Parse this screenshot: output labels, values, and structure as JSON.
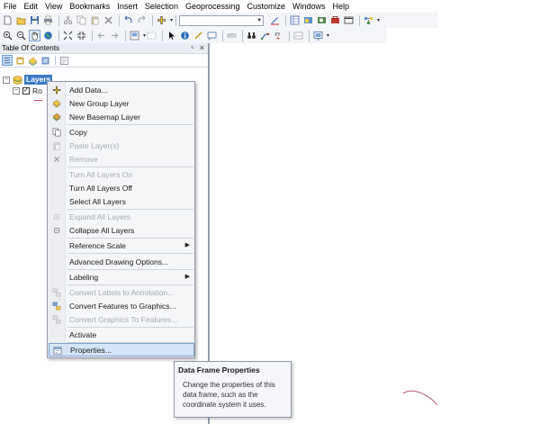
{
  "menubar": {
    "items": [
      "File",
      "Edit",
      "View",
      "Bookmarks",
      "Insert",
      "Selection",
      "Geoprocessing",
      "Customize",
      "Windows",
      "Help"
    ]
  },
  "toolbar1": {
    "buttons": [
      "new-document-icon",
      "open-icon",
      "save-icon",
      "print-icon",
      "cut-icon",
      "copy-icon",
      "paste-icon",
      "delete-icon",
      "undo-icon",
      "redo-icon",
      "add-data-icon"
    ],
    "scale_combo_value": "",
    "right_buttons": [
      "editor-icon",
      "table-icon",
      "catalog-icon",
      "search-window-icon",
      "arctoolbox-icon",
      "python-icon",
      "model-builder-icon"
    ]
  },
  "toolbar2": {
    "buttons": [
      "zoom-in-icon",
      "zoom-out-icon",
      "pan-icon",
      "full-extent-icon",
      "fixed-zoom-in-icon",
      "fixed-zoom-out-icon",
      "back-icon",
      "forward-icon",
      "layout-icon",
      "select-features-icon",
      "select-elements-icon",
      "identify-icon",
      "hyperlink-icon",
      "html-popup-icon",
      "measure-icon",
      "find-icon",
      "find-route-icon",
      "goto-xy-icon",
      "time-slider-icon",
      "viewer-icon"
    ]
  },
  "toc": {
    "title": "Table Of Contents",
    "pin_glyph": "ᛎ",
    "close_glyph": "×",
    "tree": {
      "root_label": "Layers",
      "child_label": "Ro"
    }
  },
  "context_menu": {
    "items": [
      {
        "label": "Add Data...",
        "icon": "add-data-icon",
        "enabled": true
      },
      {
        "label": "New Group Layer",
        "icon": "group-layer-icon",
        "enabled": true
      },
      {
        "label": "New Basemap Layer",
        "icon": "basemap-layer-icon",
        "enabled": true
      },
      {
        "label": "Copy",
        "icon": "copy-icon",
        "enabled": true
      },
      {
        "label": "Paste Layer(s)",
        "icon": "paste-icon",
        "enabled": false
      },
      {
        "label": "Remove",
        "icon": "remove-icon",
        "enabled": false
      },
      {
        "label": "Turn All Layers On",
        "icon": "",
        "enabled": false
      },
      {
        "label": "Turn All Layers Off",
        "icon": "",
        "enabled": true
      },
      {
        "label": "Select All Layers",
        "icon": "",
        "enabled": true
      },
      {
        "label": "Expand All Layers",
        "icon": "expand-icon",
        "enabled": false
      },
      {
        "label": "Collapse All Layers",
        "icon": "collapse-icon",
        "enabled": true
      },
      {
        "label": "Reference Scale",
        "icon": "",
        "enabled": true,
        "submenu": true
      },
      {
        "label": "Advanced Drawing Options...",
        "icon": "",
        "enabled": true
      },
      {
        "label": "Labeling",
        "icon": "",
        "enabled": true,
        "submenu": true
      },
      {
        "label": "Convert Labels to Annotation...",
        "icon": "convert-labels-icon",
        "enabled": false
      },
      {
        "label": "Convert Features to Graphics...",
        "icon": "convert-features-icon",
        "enabled": true
      },
      {
        "label": "Convert Graphics To Features...",
        "icon": "convert-graphics-icon",
        "enabled": false
      },
      {
        "label": "Activate",
        "icon": "",
        "enabled": true
      },
      {
        "label": "Properties...",
        "icon": "properties-icon",
        "enabled": true,
        "hover": true
      }
    ]
  },
  "tooltip": {
    "title": "Data Frame Properties",
    "body": "Change the properties of this data frame, such as the coordinate system it uses."
  },
  "colors": {
    "selection": "#3a79c7",
    "hover": "#d5e5f8",
    "disabled_text": "#a5a9b0",
    "map_stroke": "#b43c6e"
  }
}
